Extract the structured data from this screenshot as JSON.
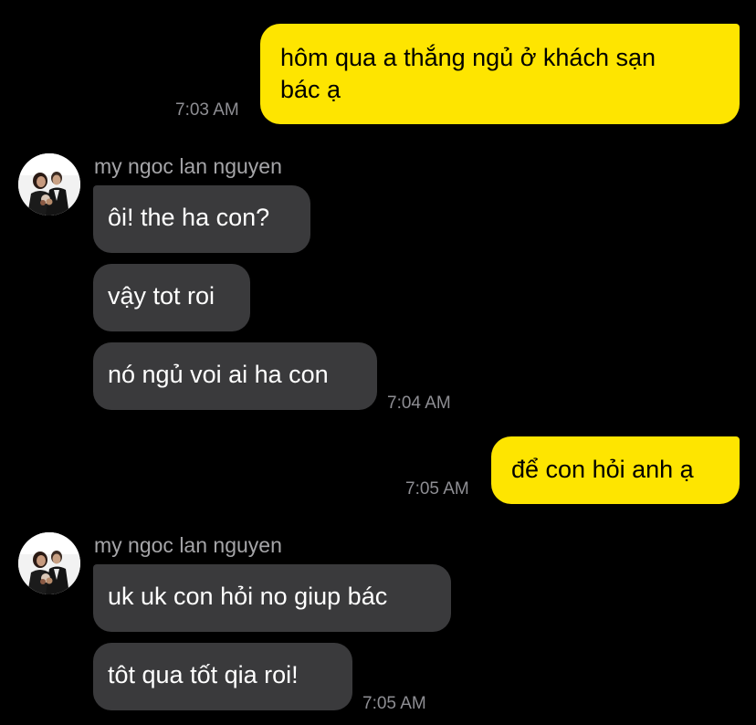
{
  "messages": [
    {
      "id": "m1",
      "direction": "outgoing",
      "text_line1": "hôm qua a thắng ngủ ở khách sạn",
      "text_line2": "bác ạ",
      "time": "7:03 AM"
    },
    {
      "id": "m2",
      "direction": "incoming",
      "sender": "my ngoc lan nguyen",
      "texts": [
        "ôi! the ha con?",
        "vậy tot roi",
        "nó ngủ voi ai ha con"
      ],
      "time": "7:04 AM"
    },
    {
      "id": "m3",
      "direction": "outgoing",
      "text": "để con hỏi anh ạ",
      "time": "7:05 AM"
    },
    {
      "id": "m4",
      "direction": "incoming",
      "sender": "my ngoc lan nguyen",
      "texts": [
        "uk uk con hỏi no giup bác",
        "tôt qua tốt qia roi!"
      ],
      "time": "7:05 AM"
    }
  ],
  "colors": {
    "background": "#000000",
    "outgoing_bubble": "#fee500",
    "incoming_bubble": "#3a3a3c",
    "timestamp": "#8e8e93",
    "sender_name": "#a5a5a8"
  },
  "icons": {
    "avatar": "profile-photo-couple-icon"
  }
}
